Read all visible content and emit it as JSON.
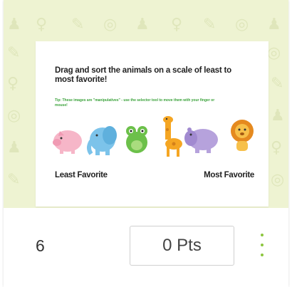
{
  "slide": {
    "prompt": "Drag and sort the animals on a scale of least to most favorite!",
    "note": "Tip: These images are \"manipulatives\" - use the selector tool to move them with your finger or mouse!",
    "scale_left_label": "Least Favorite",
    "scale_right_label": "Most Favorite",
    "animals": [
      "pig",
      "elephant",
      "frog",
      "giraffe",
      "hippo",
      "lion"
    ]
  },
  "footer": {
    "slide_number": "6",
    "points": "0 Pts"
  },
  "colors": {
    "background_tint": "#eef3d2",
    "accent": "#8dc63f",
    "note_text": "#3aa23a"
  }
}
